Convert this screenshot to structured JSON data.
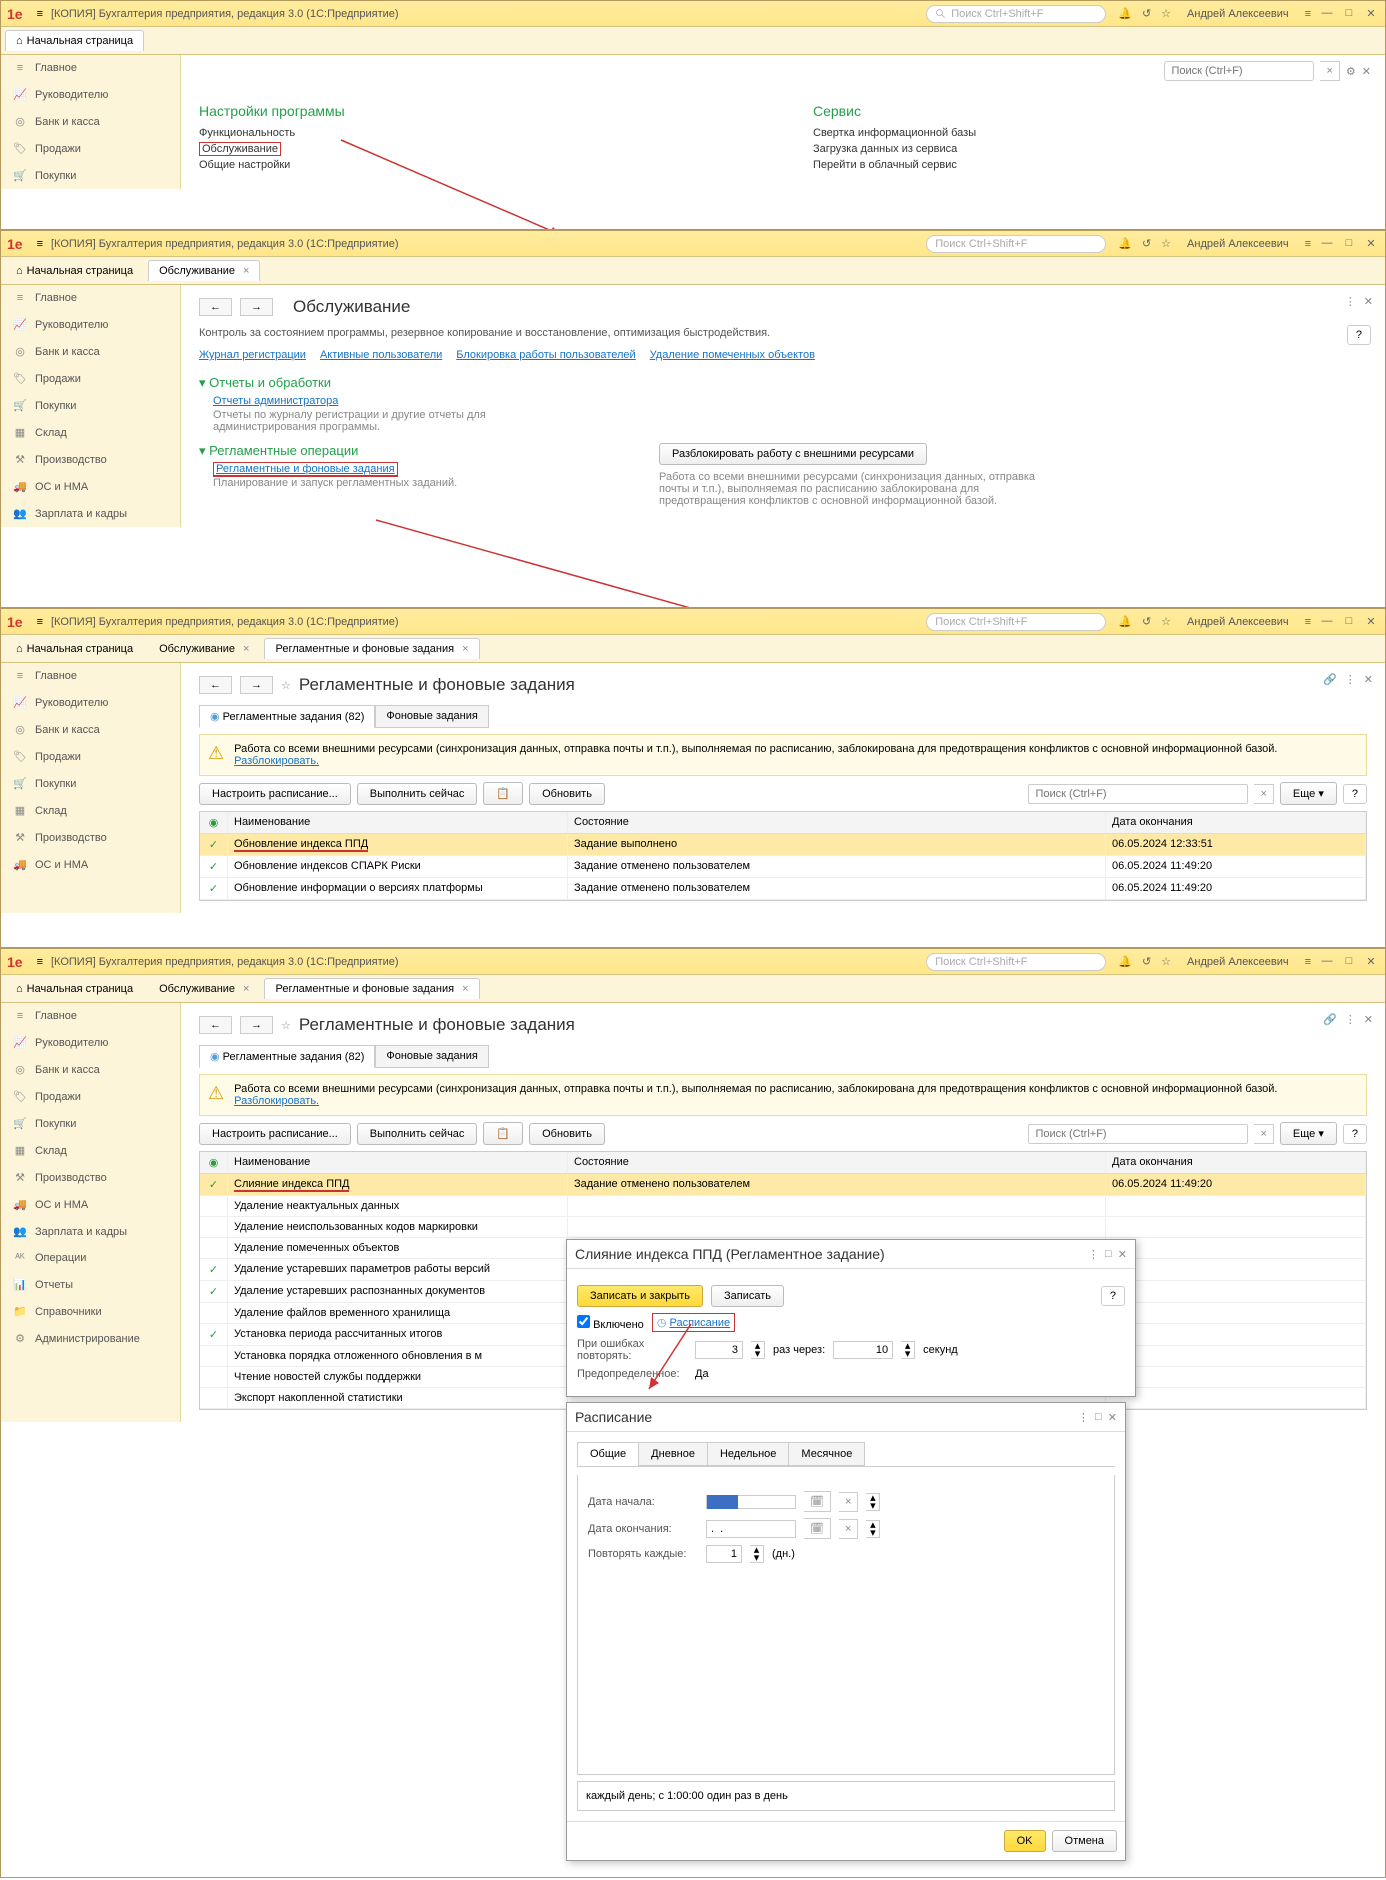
{
  "app_title": "[КОПИЯ] Бухгалтерия предприятия, редакция 3.0  (1С:Предприятие)",
  "search_placeholder": "Поиск Ctrl+Shift+F",
  "user": "Андрей Алексеевич",
  "top_search_placeholder": "Поиск (Ctrl+F)",
  "nav": {
    "home": "Начальная страница",
    "main": "Главное",
    "mgr": "Руководителю",
    "bank": "Банк и касса",
    "sales": "Продажи",
    "buy": "Покупки",
    "stock": "Склад",
    "prod": "Производство",
    "os": "ОС и НМА",
    "salary": "Зарплата и кадры",
    "ops": "Операции",
    "reports": "Отчеты",
    "refs": "Справочники",
    "admin": "Администрирование"
  },
  "screen1": {
    "settings_head": "Настройки программы",
    "service_head": "Сервис",
    "left": [
      "Функциональность",
      "Обслуживание",
      "Общие настройки"
    ],
    "right": [
      "Свертка информационной базы",
      "Загрузка данных из сервиса",
      "Перейти в облачный сервис"
    ]
  },
  "screen2": {
    "tab": "Обслуживание",
    "title": "Обслуживание",
    "desc": "Контроль за состоянием программы, резервное копирование и восстановление, оптимизация быстродействия.",
    "links": [
      "Журнал регистрации",
      "Активные пользователи",
      "Блокировка работы пользователей",
      "Удаление помеченных объектов"
    ],
    "sec1": "Отчеты и обработки",
    "sec1_link": "Отчеты администратора",
    "sec1_desc": "Отчеты по журналу регистрации и другие отчеты для администрирования программы.",
    "sec2": "Регламентные операции",
    "sec2_link": "Регламентные и фоновые задания",
    "sec2_desc": "Планирование и запуск регламентных заданий.",
    "unlock_btn": "Разблокировать работу с внешними ресурсами",
    "unlock_desc": "Работа со всеми внешними ресурсами (синхронизация данных, отправка почты и т.п.), выполняемая по расписанию заблокирована для предотвращения конфликтов с основной информационной базой."
  },
  "screen3": {
    "tab2": "Регламентные и фоновые задания",
    "title": "Регламентные и фоновые задания",
    "subtab1": "Регламентные задания (82)",
    "subtab2": "Фоновые задания",
    "warn": "Работа со всеми внешними ресурсами (синхронизация данных, отправка почты и т.п.), выполняемая по расписанию, заблокирована для предотвращения конфликтов с основной информационной базой. ",
    "warn_link": "Разблокировать.",
    "btn_sched": "Настроить расписание...",
    "btn_now": "Выполнить сейчас",
    "btn_refresh": "Обновить",
    "more": "Еще",
    "col_name": "Наименование",
    "col_state": "Состояние",
    "col_date": "Дата окончания",
    "rows": [
      {
        "ic": "✓",
        "name": "Обновление индекса ППД",
        "state": "Задание выполнено",
        "date": "06.05.2024 12:33:51",
        "sel": true,
        "hl": true
      },
      {
        "ic": "✓",
        "name": "Обновление индексов СПАРК Риски",
        "state": "Задание отменено пользователем",
        "date": "06.05.2024 11:49:20"
      },
      {
        "ic": "✓",
        "name": "Обновление информации о версиях платформы",
        "state": "Задание отменено пользователем",
        "date": "06.05.2024 11:49:20"
      }
    ]
  },
  "screen4": {
    "rows": [
      {
        "ic": "✓",
        "name": "Слияние индекса ППД",
        "state": "Задание отменено пользователем",
        "date": "06.05.2024 11:49:20",
        "sel": true,
        "hl": true
      },
      {
        "ic": "",
        "name": "Удаление неактуальных данных"
      },
      {
        "ic": "",
        "name": "Удаление неиспользованных кодов маркировки"
      },
      {
        "ic": "",
        "name": "Удаление помеченных объектов"
      },
      {
        "ic": "✓",
        "name": "Удаление устаревших параметров работы версий"
      },
      {
        "ic": "✓",
        "name": "Удаление устаревших распознанных документов"
      },
      {
        "ic": "",
        "name": "Удаление файлов временного хранилища"
      },
      {
        "ic": "✓",
        "name": "Установка периода рассчитанных итогов"
      },
      {
        "ic": "",
        "name": "Установка порядка отложенного обновления в м"
      },
      {
        "ic": "",
        "name": "Чтение новостей службы поддержки"
      },
      {
        "ic": "",
        "name": "Экспорт накопленной статистики"
      }
    ]
  },
  "dlg1": {
    "title": "Слияние индекса ППД (Регламентное задание)",
    "save_close": "Записать и закрыть",
    "save": "Записать",
    "enabled": "Включено",
    "sched_link": "Расписание",
    "err_label": "При ошибках повторять:",
    "err_times": "3",
    "err_times_unit": "раз через:",
    "err_sec": "10",
    "err_sec_unit": "секунд",
    "predef_label": "Предопределенное:",
    "predef_val": "Да"
  },
  "dlg2": {
    "title": "Расписание",
    "tabs": [
      "Общие",
      "Дневное",
      "Недельное",
      "Месячное"
    ],
    "start_label": "Дата начала:",
    "end_label": "Дата окончания:",
    "end_val": ".  .",
    "repeat_label": "Повторять каждые:",
    "repeat_val": "1",
    "repeat_unit": "(дн.)",
    "summary": "каждый день; с 1:00:00 один раз в день",
    "ok": "OK",
    "cancel": "Отмена"
  }
}
